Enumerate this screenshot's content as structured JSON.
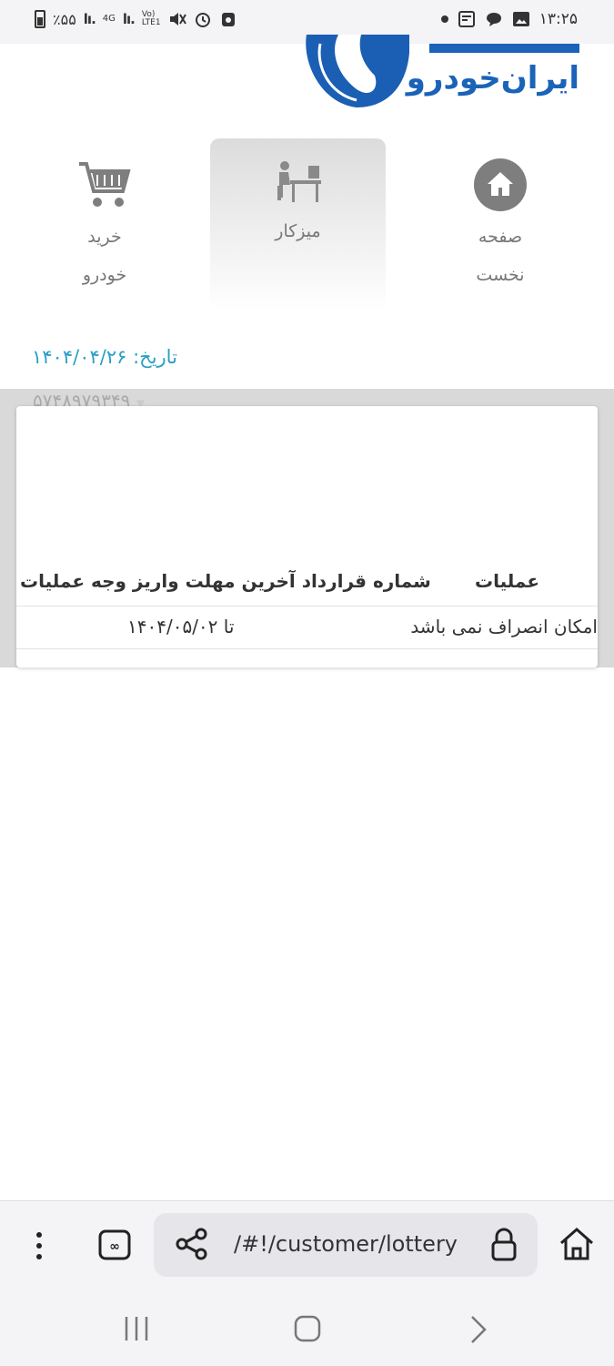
{
  "status_bar": {
    "time": "۱۳:۲۵",
    "battery_text": "٪۵۵",
    "network_4g": "4G",
    "volte_line1": "Vo)",
    "volte_line2": "LTE1"
  },
  "logo": {
    "text": "ایران‌خودرو"
  },
  "nav": {
    "home_line1": "صفحه",
    "home_line2": "نخست",
    "dashboard": "میزکار",
    "buy_line1": "خرید",
    "buy_line2": "خودرو"
  },
  "date_line": "تاریخ: ۱۴۰۴/۰۴/۲۶",
  "grey_number": "۵۷۴۸۹۷۹۳۴۹",
  "table": {
    "headers": {
      "operations": "عملیات",
      "combined": "شماره قرارداد آخرین مهلت واریز وجه عملیات"
    },
    "row": {
      "cancel_text": "امکان انصراف نمی باشد",
      "deadline": "تا ۱۴۰۴/۰۵/۰۲"
    }
  },
  "browser": {
    "url": "/#!/customer/lottery"
  }
}
